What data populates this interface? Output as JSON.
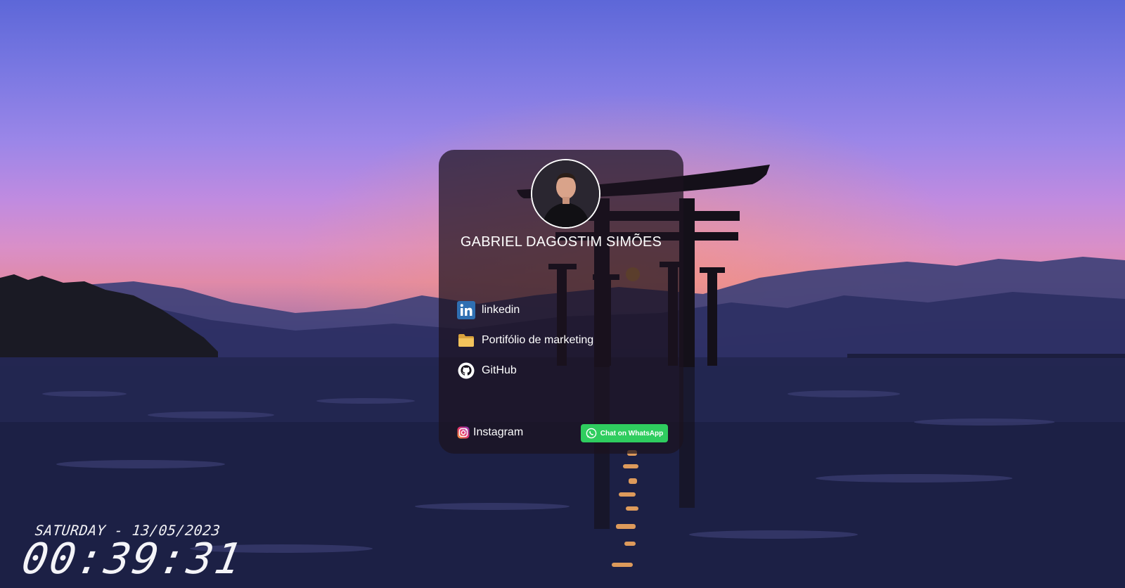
{
  "profile": {
    "name": "GABRIEL DAGOSTIM SIMÕES",
    "avatar_icon": "person-icon"
  },
  "links": [
    {
      "label": "linkedin",
      "icon": "linkedin-icon"
    },
    {
      "label": "Portifólio de marketing",
      "icon": "folder-icon"
    },
    {
      "label": "GitHub",
      "icon": "github-icon"
    }
  ],
  "instagram": {
    "label": "Instagram",
    "icon": "instagram-icon"
  },
  "whatsapp": {
    "label": "Chat on WhatsApp",
    "icon": "whatsapp-icon",
    "color": "#2fcd5f"
  },
  "clock": {
    "date": "SATURDAY - 13/05/2023",
    "time": "00:39:31"
  },
  "colors": {
    "linkedin": "#2f6fb2",
    "folder": "#e8b84a",
    "card_bg": "rgba(28,18,30,0.72)"
  }
}
